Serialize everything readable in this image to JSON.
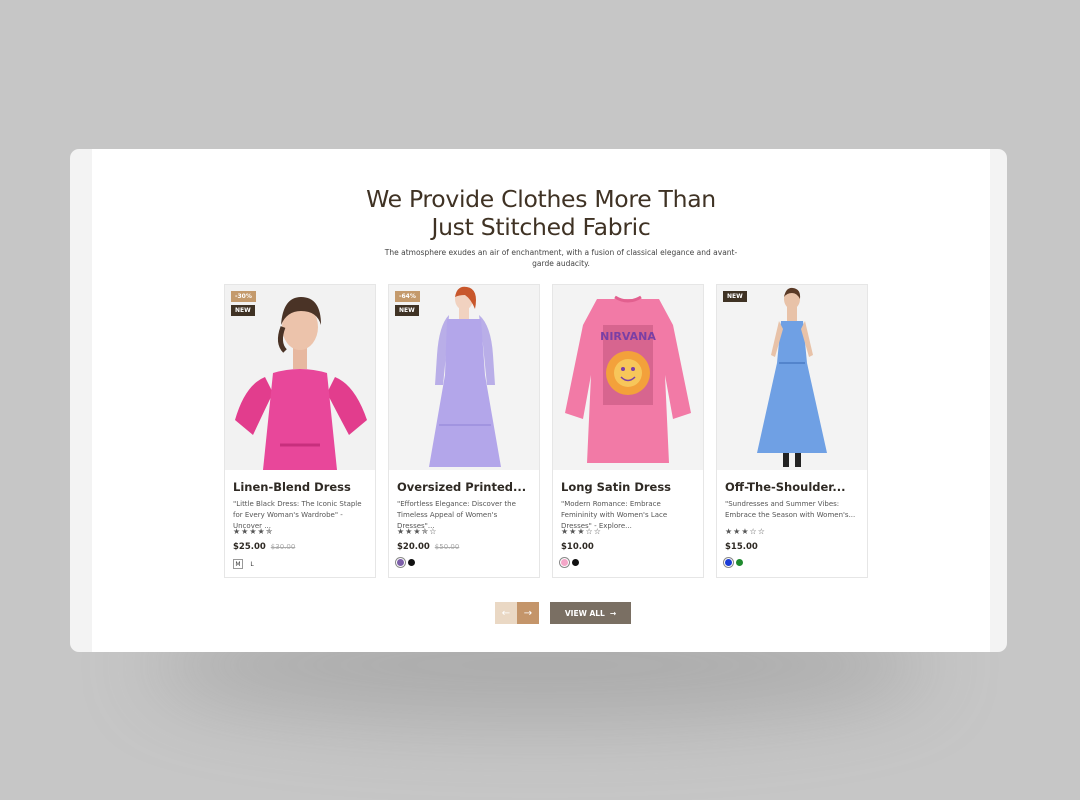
{
  "section": {
    "title_line1": "We Provide Clothes More Than",
    "title_line2": "Just Stitched Fabric",
    "subtitle": "The atmosphere exudes an air of enchantment, with a fusion of classical elegance and avant-garde audacity."
  },
  "products": [
    {
      "badges": [
        "-30%",
        "NEW"
      ],
      "name": "Linen-Blend Dress",
      "description": "\"Little Black Dress: The Iconic Staple for Every Woman's Wardrobe\" - Uncover ...",
      "stars": "★★★★✯",
      "price": "$25.00",
      "old_price": "$30.00",
      "sizes": [
        "M",
        "L"
      ],
      "swatches": [],
      "image": "model-in-pink-dress"
    },
    {
      "badges": [
        "-64%",
        "NEW"
      ],
      "name": "Oversized Printed...",
      "description": "\"Effortless Elegance: Discover the Timeless Appeal of Women's Dresses\"...",
      "stars": "★★★✯☆",
      "price": "$20.00",
      "old_price": "$50.00",
      "sizes": [],
      "swatches": [
        "#7b5ea8",
        "#111111"
      ],
      "image": "model-in-lavender-gown"
    },
    {
      "badges": [],
      "name": "Long Satin Dress",
      "description": "\"Modern Romance: Embrace Femininity with Women's Lace Dresses\" - Explore...",
      "stars": "★★★☆☆",
      "price": "$10.00",
      "old_price": "",
      "sizes": [],
      "swatches": [
        "#f4a6c8",
        "#111111"
      ],
      "image": "pink-graphic-sweatshirt"
    },
    {
      "badges": [
        "NEW"
      ],
      "name": "Off-The-Shoulder...",
      "description": "\"Sundresses and Summer Vibes: Embrace the Season with Women's...",
      "stars": "★★★☆☆",
      "price": "$15.00",
      "old_price": "",
      "sizes": [],
      "swatches": [
        "#1a3bd6",
        "#1f8a2e"
      ],
      "image": "model-in-blue-dress"
    }
  ],
  "controls": {
    "prev_icon": "←",
    "next_icon": "→",
    "view_all_label": "VIEW ALL",
    "view_all_icon": "→"
  },
  "colors": {
    "accent": "#c4956a",
    "accent_light": "#ead8c4",
    "dark": "#3f3224",
    "button": "#7a6f63"
  }
}
